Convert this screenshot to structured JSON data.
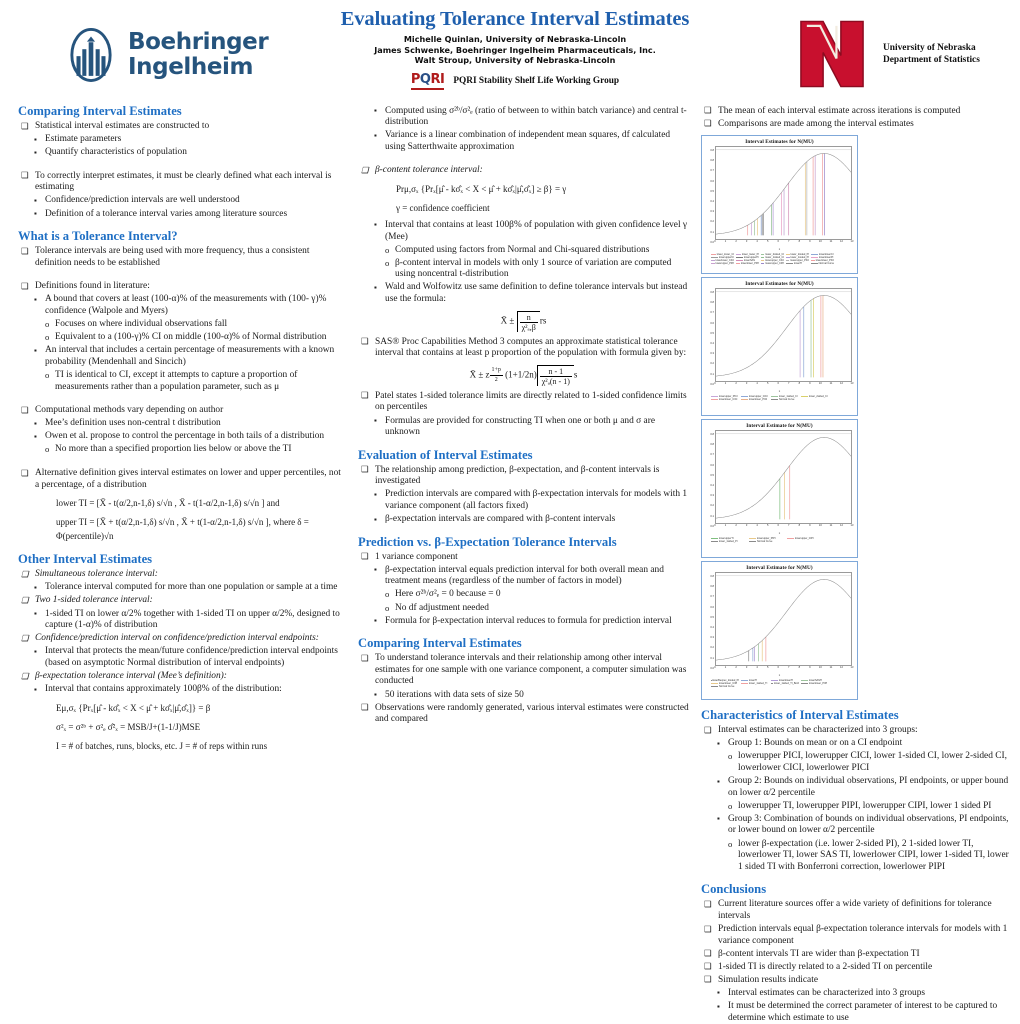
{
  "header": {
    "bi_logo_line1": "Boehringer",
    "bi_logo_line2": "Ingelheim",
    "title": "Evaluating Tolerance Interval Estimates",
    "authors": [
      "Michelle Quinlan, University of Nebraska-Lincoln",
      "James Schwenke, Boehringer Ingelheim Pharmaceuticals, Inc.",
      "Walt Stroup, University of Nebraska-Lincoln"
    ],
    "pqri_mark_left": "P",
    "pqri_mark_o": "Q",
    "pqri_mark_right": "RI",
    "pqri_text": "PQRI Stability Shelf Life Working Group",
    "unl_line1": "University of Nebraska",
    "unl_line2": "Department of Statistics",
    "unl_letter": "N"
  },
  "col1": {
    "s1_title": "Comparing Interval Estimates",
    "s1_b1": "Statistical interval estimates are constructed to",
    "s1_b2a": "Estimate parameters",
    "s1_b2b": "Quantify characteristics of population",
    "s1_b3": "To correctly interpret estimates, it must be clearly defined what each interval is estimating",
    "s1_b4a": "Confidence/prediction intervals are well understood",
    "s1_b4b": "Definition of a tolerance interval varies among literature sources",
    "s2_title": "What is a Tolerance Interval?",
    "s2_b1": "Tolerance intervals are being used with more frequency, thus a consistent definition needs to be established",
    "s2_b2": "Definitions found in literature:",
    "s2_b3": "A bound that covers at least (100-α)% of the measurements with (100- γ)% confidence (Walpole and Myers)",
    "s2_b4": "Focuses on where individual observations fall",
    "s2_b5": "Equivalent to a (100-γ)% CI on middle (100-α)% of Normal distribution",
    "s2_b6": "An interval that includes a certain percentage of measurements with a known probability (Mendenhall and Sincich)",
    "s2_b7": "TI is identical to CI, except it attempts to capture a proportion of measurements rather than a population parameter, such as μ",
    "s2_b8": "Computational methods vary depending on author",
    "s2_b9": "Mee’s definition uses non-central t distribution",
    "s2_b10": "Owen et al. propose to control the percentage in both tails of a distribution",
    "s2_b11": "No more than a specified proportion lies below or above the TI",
    "s2_b12": "Alternative definition gives interval estimates on lower and upper percentiles, not a percentage, of a distribution",
    "f_lower_label": "lower TI = [",
    "f_upper_label": "upper TI = [",
    "f_lower": "lower TI = [X̄ - t(α/2,n-1,δ) s/√n ,  X̄ - t(1-α/2,n-1,δ) s/√n ] and",
    "f_upper": "upper TI = [X̄ + t(α/2,n-1,δ) s/√n ,  X̄ + t(1-α/2,n-1,δ) s/√n ], where δ = Φ(percentile)√n",
    "s3_title": "Other Interval Estimates",
    "s3_b1": "Simultaneous tolerance interval:",
    "s3_b2": "Tolerance interval computed for more than one population or sample at a time",
    "s3_b3": "Two 1-sided tolerance interval:",
    "s3_b4": "1-sided TI on lower α/2% together with 1-sided TI on upper α/2%, designed to capture (1-α)% of distribution",
    "s3_b5": "Confidence/prediction interval on confidence/prediction interval endpoints:",
    "s3_b6": "Interval that protects the mean/future confidence/prediction interval endpoints (based on asymptotic Normal distribution of interval endpoints)",
    "s3_b7": "β-expectation tolerance interval (Mee’s definition):",
    "s3_b8": "Interval that contains approximately 100β% of the distribution:",
    "f_e": "Eμ,σₓ {Prₓ[μ̂ - kσ̂ₓ < X < μ̂ + kσ̂ₓ|μ̂,σ̂ₓ]} = β",
    "f_var": "σ²ₓ = σ²ᵇ + σ²ₑ        σ̂²ₓ = MSB/J+(1-1/J)MSE",
    "f_def": "I = # of batches, runs, blocks, etc.    J = # of reps within runs"
  },
  "col2": {
    "t1_b1": "Computed using σ²ᵇ/σ²ₑ (ratio of between to within batch variance) and central t-distribution",
    "t1_b2": "Variance is a linear combination of independent mean squares, df calculated using Satterthwaite approximation",
    "t1_b3": "β-content tolerance interval:",
    "f_pr": "Prμ,σₓ {Prₓ[μ̂ - kσ̂ₓ < X < μ̂ + kσ̂ₓ|μ̂,σ̂ₓ] ≥ β} = γ",
    "f_gamma": "γ = confidence coefficient",
    "t1_b4": "Interval that contains at least 100β% of population with given confidence level γ (Mee)",
    "t1_b5": "Computed using factors from Normal and Chi-squared distributions",
    "t1_b6": "β-content interval in models with only 1 source of variation are computed using noncentral t-distribution",
    "t1_b7": "Wald and Wolfowitz use same definition to define tolerance intervals but instead use the formula:",
    "f_wald_pre": "X̄ ±",
    "f_wald_num": "n",
    "f_wald_den": "χ²ₐ,β",
    "f_wald_post": "rs",
    "t1_b8": "SAS® Proc Capabilities Method 3 computes an approximate statistical tolerance interval that contains at least p proportion of the population with formula given by:",
    "f_sas_pre": "X̄ ± z",
    "f_sas_sub_num": "1+p",
    "f_sas_sub_den": "2",
    "f_sas_mid": "(1+1/2n)",
    "f_sas_num": "n - 1",
    "f_sas_den": "χ²ₐ(n - 1)",
    "f_sas_post": "s",
    "t1_b9": "Patel states 1-sided tolerance limits are directly related to 1-sided confidence limits on percentiles",
    "t1_b10": "Formulas are provided for constructing TI when one or both μ and σ are unknown",
    "s4_title": "Evaluation of Interval Estimates",
    "s4_b1": "The relationship among prediction, β-expectation, and β-content intervals is investigated",
    "s4_b2": "Prediction intervals are compared with β-expectation intervals for models with 1 variance component (all factors fixed)",
    "s4_b3": "β-expectation intervals are compared with β-content intervals",
    "s5_title": "Prediction vs. β-Expectation Tolerance Intervals",
    "s5_b1": "1 variance component",
    "s5_b2": "β-expectation interval equals prediction interval for both overall mean and treatment means (regardless of the number of factors in model)",
    "s5_b3": "Here σ²ᵇ/σ²ₑ = 0 because      = 0",
    "s5_b4": "No df adjustment needed",
    "s5_b5": "Formula for β-expectation interval reduces to formula for prediction interval",
    "s6_title": "Comparing Interval Estimates",
    "s6_b1": "To understand tolerance intervals and their relationship among other interval estimates for one sample with one variance component, a computer simulation was conducted",
    "s6_b2": "50 iterations with data sets of size 50",
    "s6_b3": "Observations were randomly generated, various interval estimates were constructed and compared"
  },
  "col3": {
    "r1_b1": "The mean of each interval estimate across iterations is computed",
    "r1_b2": "Comparisons are made among the interval estimates",
    "s7_title": "Characteristics of Interval Estimates",
    "s7_b1": "Interval estimates can be characterized into 3 groups:",
    "s7_b2": "Group 1: Bounds on mean or on a CI endpoint",
    "s7_b3": "lowerupper PICI, lowerupper CICI, lower 1-sided CI, lower 2-sided CI, lowerlower CICI, lowerlower PICI",
    "s7_b4": "Group 2: Bounds on individual observations, PI endpoints, or upper bound on lower α/2 percentile",
    "s7_b5": "lowerupper TI, lowerupper PIPI, lowerupper CIPI, lower 1 sided PI",
    "s7_b6": "Group 3: Combination of bounds on individual observations, PI endpoints, or lower bound on lower α/2 percentile",
    "s7_b7": "lower β-expectation (i.e. lower 2-sided PI), 2 1-sided lower TI, lowerlower TI, lower SAS TI, lowerlower CIPI, lower 1-sided TI, lower 1 sided TI with Bonferroni correction, lowerlower PIPI",
    "s8_title": "Conclusions",
    "s8_b1": "Current literature sources offer a wide variety of definitions for tolerance intervals",
    "s8_b2": "Prediction intervals equal β-expectation tolerance intervals for models with 1 variance component",
    "s8_b3": "β-content intervals TI are wider than β-expectation TI",
    "s8_b4": "1-sided TI is directly related to a 2-sided TI on percentile",
    "s8_b5": "Simulation results indicate",
    "s8_b6": "Interval estimates can be characterized into 3 groups",
    "s8_b7": "It must be determined the correct parameter of interest to be captured to determine which estimate to use"
  },
  "chart_data": [
    {
      "type": "line",
      "title": "Interval Estimates for N(MU)",
      "xlabel": "x",
      "ylabel": "",
      "xlim": [
        0,
        13
      ],
      "ylim": [
        0.0,
        0.8
      ],
      "xticks": [
        "0",
        "1",
        "2",
        "3",
        "4",
        "5",
        "6",
        "7",
        "8",
        "9",
        "10",
        "11",
        "12",
        "13"
      ],
      "yticks": [
        "0.8",
        "0.8",
        "0.7",
        "0.6",
        "0.5",
        "0.4",
        "0.3",
        "0.2",
        "0.1",
        "0.0"
      ],
      "curve_name": "Normal Curve",
      "vlines": [
        {
          "x": 3.05,
          "color": "#f0a0a0"
        },
        {
          "x": 3.4,
          "color": "#c9a3d6"
        },
        {
          "x": 3.7,
          "color": "#9cc49c"
        },
        {
          "x": 4.0,
          "color": "#e8c98a"
        },
        {
          "x": 4.35,
          "color": "#8fa8d6"
        },
        {
          "x": 4.45,
          "color": "#9a9a9a"
        },
        {
          "x": 4.55,
          "color": "#7b7b7b"
        },
        {
          "x": 5.35,
          "color": "#8fbf8f"
        },
        {
          "x": 5.5,
          "color": "#b09ad6"
        },
        {
          "x": 6.3,
          "color": "#e7a2c6"
        },
        {
          "x": 6.55,
          "color": "#bfa0d0"
        },
        {
          "x": 7.0,
          "color": "#d18fb8"
        },
        {
          "x": 8.6,
          "color": "#e8c98a"
        },
        {
          "x": 8.75,
          "color": "#b7b7b7"
        },
        {
          "x": 9.35,
          "color": "#f09e9e"
        },
        {
          "x": 9.55,
          "color": "#c9a0cf"
        },
        {
          "x": 10.25,
          "color": "#f0a0a0"
        },
        {
          "x": 10.45,
          "color": "#9a86c9"
        }
      ],
      "legend": [
        "lower_lower_CI",
        "lower_lower_PI",
        "lower_2sided_CI",
        "lower_2sided_PI",
        "lowerlowerCI",
        "lowerupperCI",
        "lowerupperPI",
        "lower_1sided_CI",
        "lower_1sided_PI",
        "lowerlowerPI",
        "lowerlower_CICI",
        "lowerSAS",
        "lowerupper_CICI",
        "lowerupper_PICI",
        "lowerlower_PICI",
        "lowerupper_PIPI",
        "lowerlower_PIPI",
        "lowerupper_CIPI",
        "lowerTI",
        "Normal Curve"
      ]
    },
    {
      "type": "line",
      "title": "Interval Estimates for N(MU)",
      "xlabel": "x",
      "ylabel": "",
      "xlim": [
        0,
        13
      ],
      "ylim": [
        0.0,
        0.8
      ],
      "xticks": [
        "0",
        "1",
        "2",
        "3",
        "4",
        "5",
        "6",
        "7",
        "8",
        "9",
        "10",
        "11",
        "12",
        "13"
      ],
      "yticks": [
        "0.8",
        "0.8",
        "0.7",
        "0.6",
        "0.5",
        "0.4",
        "0.3",
        "0.2",
        "0.1",
        "0.0"
      ],
      "curve_name": "Normal Curve",
      "vlines": [
        {
          "x": 8.1,
          "color": "#c6a7d8"
        },
        {
          "x": 8.45,
          "color": "#8fa8d6"
        },
        {
          "x": 9.15,
          "color": "#9cc49c"
        },
        {
          "x": 9.4,
          "color": "#d9d06a"
        },
        {
          "x": 10.1,
          "color": "#f0a0a0"
        },
        {
          "x": 10.3,
          "color": "#e8b08a"
        }
      ],
      "legend": [
        "lowerupper_PICI",
        "lowerupper_CICI",
        "lower_1sided_CI",
        "lower_2sided_CI",
        "lowerlower_CICI",
        "lowerlower_PICI",
        "Normal Curve"
      ]
    },
    {
      "type": "line",
      "title": "Interval Estimate for N(MU)",
      "xlabel": "x",
      "ylabel": "",
      "xlim": [
        0,
        13
      ],
      "ylim": [
        0.0,
        0.8
      ],
      "xticks": [
        "0",
        "1",
        "2",
        "3",
        "4",
        "5",
        "6",
        "7",
        "8",
        "9",
        "10",
        "11",
        "12",
        "13"
      ],
      "yticks": [
        "0.8",
        "0.8",
        "0.7",
        "0.6",
        "0.5",
        "0.4",
        "0.3",
        "0.2",
        "0.1",
        "0.0"
      ],
      "curve_name": "Normal Curve",
      "vlines": [
        {
          "x": 6.15,
          "color": "#7fbf7f"
        },
        {
          "x": 6.6,
          "color": "#e8c98a"
        },
        {
          "x": 7.1,
          "color": "#f0a0a0"
        }
      ],
      "legend": [
        "lowerupperTI",
        "lowerupper_PIPI",
        "lowerupper_CIPI",
        "lower_1sided_PI",
        "Normal Curve"
      ]
    },
    {
      "type": "line",
      "title": "Interval Estimate for N(MU)",
      "xlabel": "x",
      "ylabel": "",
      "xlim": [
        0,
        13
      ],
      "ylim": [
        0.0,
        0.8
      ],
      "xticks": [
        "0",
        "1",
        "2",
        "3",
        "4",
        "5",
        "6",
        "7",
        "8",
        "9",
        "10",
        "11",
        "12",
        "13"
      ],
      "yticks": [
        "0.8",
        "0.8",
        "0.7",
        "0.6",
        "0.5",
        "0.4",
        "0.3",
        "0.2",
        "0.1",
        "0.0"
      ],
      "curve_name": "Normal Curve",
      "vlines": [
        {
          "x": 3.15,
          "color": "#8a8a8a"
        },
        {
          "x": 3.55,
          "color": "#8fa8d6"
        },
        {
          "x": 3.7,
          "color": "#b09ad6"
        },
        {
          "x": 4.1,
          "color": "#9cc49c"
        },
        {
          "x": 4.45,
          "color": "#e8c98a"
        },
        {
          "x": 4.8,
          "color": "#f0a0a0"
        }
      ],
      "legend": [
        "lowerBexpec_2sided_PI",
        "lowerTI",
        "lowerlowerTI",
        "lowerSASTI",
        "lowerlower_CIPI",
        "lower_1sided_TI",
        "lower_1sided_TI_Bonf",
        "lowerlower_PIPI",
        "Normal Curve"
      ]
    }
  ]
}
